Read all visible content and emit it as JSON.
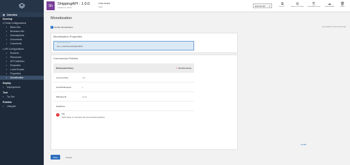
{
  "sidebar": {
    "overview": "Overview",
    "develop": "Develop",
    "portal_configurations": "Portal Configurations",
    "portal_items": [
      "Basic Info",
      "Business Info",
      "Subscriptions",
      "Documents",
      "Comments"
    ],
    "api_configurations": "API Configurations",
    "api_items": [
      "Runtime",
      "Resources",
      "API Definition",
      "Endpoints",
      "Local Scopes",
      "Properties",
      "Monetization"
    ],
    "deploy": "Deploy",
    "deployments": "Deployments",
    "test": "Test",
    "try_out": "Try Out",
    "publish": "Publish",
    "lifecycle": "Lifecycle"
  },
  "header": {
    "thumb": "Sh",
    "api_name": "ShippingAPI : 1.0.0",
    "created_by": "Created by: admin",
    "state": "PUBLISHED",
    "state_sub": "State",
    "gateway": "Exclude API",
    "actions": [
      "Dev Po...",
      "Keep in Dev Portal",
      "Create New Version",
      "Download API",
      "Delete"
    ]
  },
  "main": {
    "title": "Monetization",
    "updated": "Last updated: a few seconds ago",
    "enable_label": "Enable Monetization",
    "properties_title": "Monetization Properties",
    "prop_field_label": "connectedAccountKey",
    "prop_field_value": "acct_1GDtSKAAD3pE7Rb9z",
    "policies_title": "Commercial Policies",
    "policy_name": "RCDynamicPolicy",
    "not_monetized": "Not Monetized",
    "rows": [
      {
        "key": "currencyType",
        "value": "usd"
      },
      {
        "key": "pricePerRequest",
        "value": "1"
      },
      {
        "key": "billingCycle",
        "value": "week"
      },
      {
        "key": "fixedPrice",
        "value": ""
      }
    ],
    "info_title": "Info",
    "info_text": "Click Save to monetize all unmonetized policies",
    "close": "CLOSE",
    "save": "Save",
    "cancel": "Cancel"
  }
}
